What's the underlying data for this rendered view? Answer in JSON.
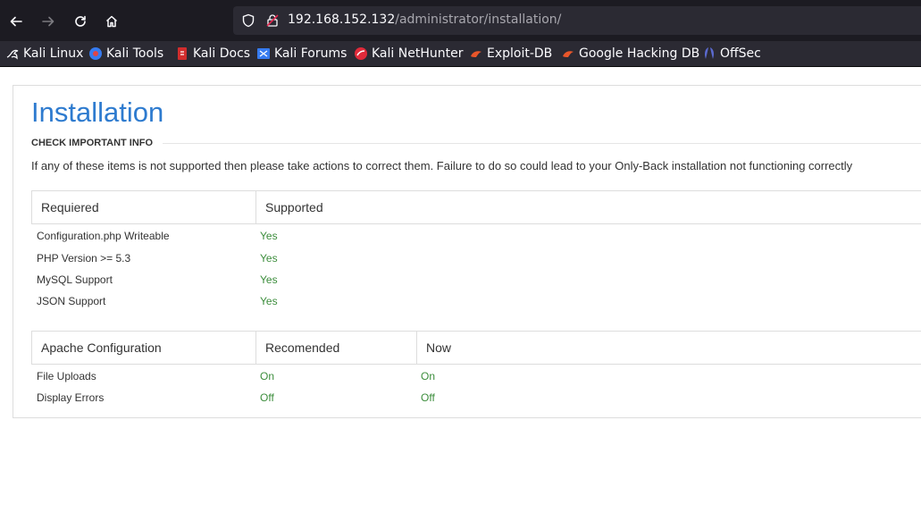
{
  "browser": {
    "url_host": "192.168.152.132",
    "url_path": "/administrator/installation/",
    "bookmarks": [
      {
        "label": "Kali Linux",
        "icon": "kali-dragon-icon"
      },
      {
        "label": "Kali Tools",
        "icon": "kali-tools-icon"
      },
      {
        "label": "Kali Docs",
        "icon": "kali-docs-icon"
      },
      {
        "label": "Kali Forums",
        "icon": "kali-forums-icon"
      },
      {
        "label": "Kali NetHunter",
        "icon": "kali-nethunter-icon"
      },
      {
        "label": "Exploit-DB",
        "icon": "exploit-db-icon"
      },
      {
        "label": "Google Hacking DB",
        "icon": "ghdb-icon"
      },
      {
        "label": "OffSec",
        "icon": "offsec-icon"
      }
    ]
  },
  "page": {
    "title": "Installation",
    "section_label": "CHECK IMPORTANT INFO",
    "info_text": "If any of these items is not supported then please take actions to correct them. Failure to do so could lead to your Only-Back installation not functioning correctly",
    "requirements_table": {
      "headers": [
        "Requiered",
        "Supported"
      ],
      "rows": [
        {
          "name": "Configuration.php Writeable",
          "status": "Yes"
        },
        {
          "name": "PHP Version >= 5.3",
          "status": "Yes"
        },
        {
          "name": "MySQL Support",
          "status": "Yes"
        },
        {
          "name": "JSON Support",
          "status": "Yes"
        }
      ]
    },
    "apache_table": {
      "headers": [
        "Apache Configuration",
        "Recomended",
        "Now"
      ],
      "rows": [
        {
          "name": "File Uploads",
          "recommended": "On",
          "now": "On"
        },
        {
          "name": "Display Errors",
          "recommended": "Off",
          "now": "Off"
        }
      ]
    }
  },
  "colors": {
    "title_blue": "#2e7bcf",
    "status_green": "#3c8d3c",
    "chrome_dark": "#1c1b22"
  }
}
